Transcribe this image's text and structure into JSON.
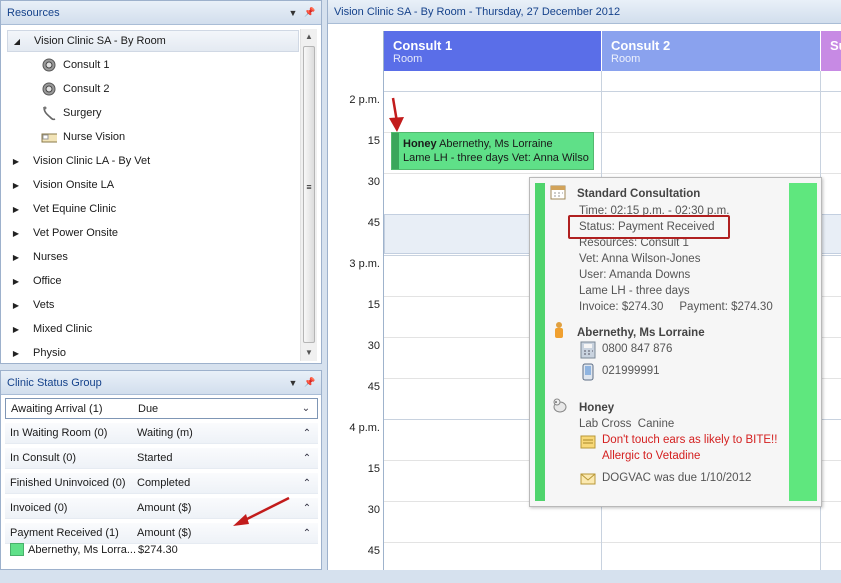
{
  "resources_panel": {
    "title": "Resources",
    "items": [
      {
        "label": "Vision Clinic SA - By Room",
        "expanded": true,
        "level": 0,
        "icon": "none"
      },
      {
        "label": "Consult 1",
        "level": 1,
        "icon": "stethoscope-icon"
      },
      {
        "label": "Consult 2",
        "level": 1,
        "icon": "stethoscope-icon"
      },
      {
        "label": "Surgery",
        "level": 1,
        "icon": "surgery-icon"
      },
      {
        "label": "Nurse Vision",
        "level": 1,
        "icon": "bed-icon"
      },
      {
        "label": "Vision Clinic LA - By Vet",
        "level": 0,
        "icon": "none"
      },
      {
        "label": "Vision Onsite LA",
        "level": 0,
        "icon": "none"
      },
      {
        "label": "Vet Equine Clinic",
        "level": 0,
        "icon": "none"
      },
      {
        "label": "Vet Power Onsite",
        "level": 0,
        "icon": "none"
      },
      {
        "label": "Nurses",
        "level": 0,
        "icon": "none"
      },
      {
        "label": "Office",
        "level": 0,
        "icon": "none"
      },
      {
        "label": "Vets",
        "level": 0,
        "icon": "none"
      },
      {
        "label": "Mixed Clinic",
        "level": 0,
        "icon": "none"
      },
      {
        "label": "Physio",
        "level": 0,
        "icon": "none"
      }
    ]
  },
  "status_panel": {
    "title": "Clinic Status Group",
    "rows": [
      {
        "status": "Awaiting Arrival (1)",
        "column": "Due",
        "chevron": "down"
      },
      {
        "status": "In Waiting Room (0)",
        "column": "Waiting (m)",
        "chevron": "up"
      },
      {
        "status": "In Consult (0)",
        "column": "Started",
        "chevron": "up"
      },
      {
        "status": "Finished Uninvoiced (0)",
        "column": "Completed",
        "chevron": "up"
      },
      {
        "status": "Invoiced (0)",
        "column": "Amount ($)",
        "chevron": "up"
      },
      {
        "status": "Payment Received (1)",
        "column": "Amount ($)",
        "chevron": "up"
      }
    ],
    "entry": {
      "name": "Abernethy, Ms Lorra...",
      "amount": "$274.30",
      "color": "#5fe088"
    }
  },
  "calendar": {
    "title": "Vision Clinic SA - By Room - Thursday, 27 December 2012",
    "columns": [
      {
        "name": "Consult 1",
        "sub": "Room",
        "color": "#5a6ee8"
      },
      {
        "name": "Consult 2",
        "sub": "Room",
        "color": "#8aa2ee"
      },
      {
        "name": "Su",
        "sub": "",
        "color": "#c78ae4"
      }
    ],
    "times": [
      "2 p.m.",
      "15",
      "30",
      "45",
      "3 p.m.",
      "15",
      "30",
      "45",
      "4 p.m.",
      "15",
      "30",
      "45"
    ],
    "appointment": {
      "patient": "Honey",
      "client": "Abernethy, Ms Lorraine",
      "line2": "Lame LH - three days  Vet: Anna Wilso"
    },
    "tooltip": {
      "title": "Standard Consultation",
      "time": "Time: 02:15 p.m. - 02:30 p.m.",
      "status": "Status: Payment Received",
      "resources": "Resources: Consult 1",
      "vet": "Vet: Anna Wilson-Jones",
      "user": "User: Amanda Downs",
      "reason": "Lame LH - three days",
      "invoice": "Invoice: $274.30     Payment: $274.30",
      "client_name": "Abernethy, Ms Lorraine",
      "phone1": "0800 847 876",
      "phone2": "021999991",
      "pet_name": "Honey",
      "breed": "Lab Cross  Canine",
      "warning1": "Don't touch ears as likely to BITE!!",
      "warning2": "Allergic to Vetadine",
      "reminder": "DOGVAC was due 1/10/2012"
    }
  }
}
